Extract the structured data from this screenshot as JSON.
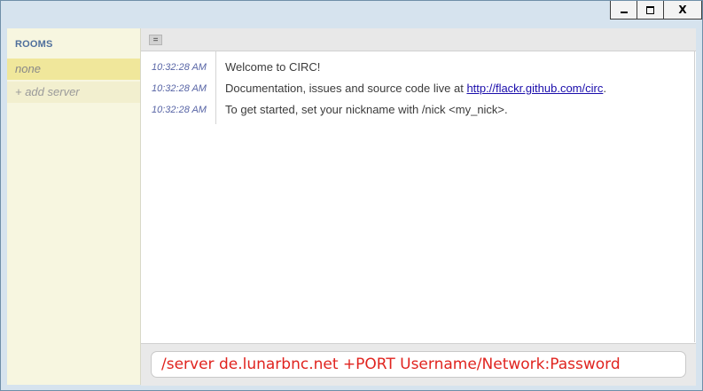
{
  "window": {
    "buttons": {
      "minimize_icon": "minimize-icon",
      "maximize_icon": "maximize-icon",
      "close_icon": "close-icon",
      "close_glyph": "X"
    }
  },
  "sidebar": {
    "header": "ROOMS",
    "rooms": [
      {
        "label": "none"
      }
    ],
    "add_server": "+ add server"
  },
  "toolbar": {
    "menu_glyph": "="
  },
  "messages": [
    {
      "time": "10:32:28 AM",
      "text": "Welcome to CIRC!"
    },
    {
      "time": "10:32:28 AM",
      "text_before": "Documentation, issues and source code live at ",
      "link": "http://flackr.github.com/circ",
      "text_after": "."
    },
    {
      "time": "10:32:28 AM",
      "text": "To get started, set your nickname with /nick <my_nick>."
    }
  ],
  "input": {
    "value": "/server de.lunarbnc.net +PORT Username/Network:Password"
  },
  "colors": {
    "input_text": "#e0241f",
    "rooms_header": "#4f6f9c",
    "timestamp": "#5865a6",
    "link": "#1a0dab",
    "selected_room": "#f0e79b"
  }
}
